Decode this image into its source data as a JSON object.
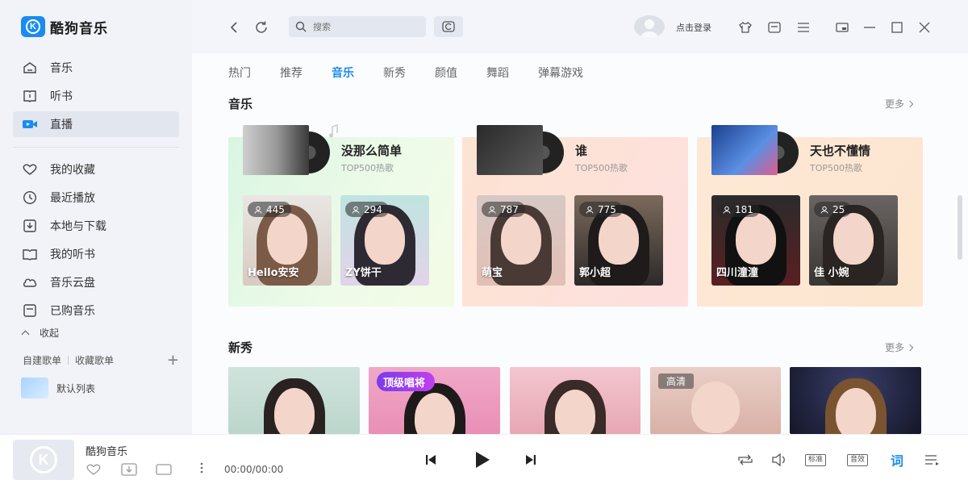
{
  "app": {
    "name": "酷狗音乐",
    "logo_letter": "K"
  },
  "sidebar": {
    "items": [
      {
        "label": "音乐",
        "icon": "home-icon"
      },
      {
        "label": "听书",
        "icon": "book-icon"
      },
      {
        "label": "直播",
        "icon": "live-icon",
        "active": true
      },
      {
        "label": "我的收藏",
        "icon": "heart-icon"
      },
      {
        "label": "最近播放",
        "icon": "clock-icon"
      },
      {
        "label": "本地与下载",
        "icon": "download-icon"
      },
      {
        "label": "我的听书",
        "icon": "open-book-icon"
      },
      {
        "label": "音乐云盘",
        "icon": "cloud-icon"
      },
      {
        "label": "已购音乐",
        "icon": "purchased-icon"
      }
    ],
    "collapse_label": "收起",
    "playlist_tabs": [
      "自建歌单",
      "收藏歌单"
    ],
    "playlist_add": "+",
    "default_list": "默认列表"
  },
  "topbar": {
    "search_placeholder": "搜索",
    "login_label": "点击登录"
  },
  "tabs": [
    {
      "label": "热门"
    },
    {
      "label": "推荐"
    },
    {
      "label": "音乐",
      "active": true
    },
    {
      "label": "新秀"
    },
    {
      "label": "颜值"
    },
    {
      "label": "舞蹈"
    },
    {
      "label": "弹幕游戏"
    }
  ],
  "music_section": {
    "title": "音乐",
    "more": "更多",
    "cards": [
      {
        "song": "没那么简单",
        "sub": "TOP500热歌",
        "streamers": [
          {
            "count": "445",
            "name": "Hello安安"
          },
          {
            "count": "294",
            "name": "ZY饼干"
          }
        ]
      },
      {
        "song": "谁",
        "sub": "TOP500热歌",
        "streamers": [
          {
            "count": "787",
            "name": "萌宝"
          },
          {
            "count": "775",
            "name": "郭小超"
          }
        ]
      },
      {
        "song": "天也不懂情",
        "sub": "TOP500热歌",
        "streamers": [
          {
            "count": "181",
            "name": "四川潼潼"
          },
          {
            "count": "25",
            "name": "佳 小婉"
          }
        ]
      }
    ]
  },
  "new_section": {
    "title": "新秀",
    "more": "更多",
    "banner": "顶级唱将",
    "hd_tag": "高清"
  },
  "player": {
    "title": "酷狗音乐",
    "time": "00:00/00:00",
    "standard_label": "标准",
    "effect_label": "音效",
    "lyric_label": "词"
  }
}
